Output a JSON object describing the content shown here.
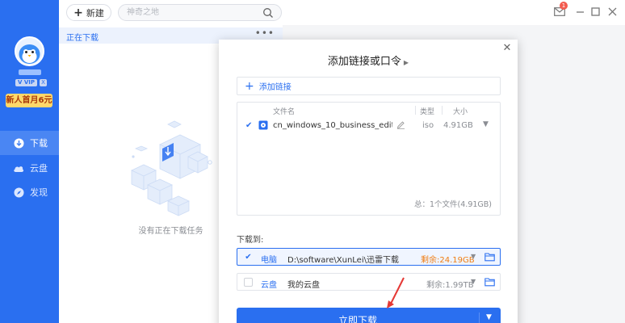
{
  "sidebar": {
    "promo_label": "新人首月6元",
    "vip_badge": "V VIP",
    "vip_x": "X",
    "nav": [
      {
        "label": "下载",
        "icon": "download-icon",
        "active": true
      },
      {
        "label": "云盘",
        "icon": "cloud-icon",
        "active": false
      },
      {
        "label": "发现",
        "icon": "compass-icon",
        "active": false
      }
    ]
  },
  "topbar": {
    "new_button": "新建",
    "search_placeholder": "神奇之地",
    "mail_badge_count": "1"
  },
  "download_list": {
    "header": "正在下载",
    "more": "•••",
    "empty_text": "没有正在下载任务"
  },
  "dialog": {
    "title": "添加链接或口令",
    "add_link_label": "添加链接",
    "columns": {
      "name": "文件名",
      "type": "类型",
      "size": "大小"
    },
    "file": {
      "name": "cn_windows_10_business_edition...",
      "type": "iso",
      "size": "4.91GB"
    },
    "total": "总：1个文件(4.91GB)",
    "save_to_label": "下载到:",
    "destinations": [
      {
        "label": "电脑",
        "path": "D:\\software\\XunLei\\迅雷下载",
        "free": "剩余:24.19GB",
        "checked": true
      },
      {
        "label": "云盘",
        "path": "我的云盘",
        "free": "剩余:1.99TB",
        "checked": false
      }
    ],
    "download_button": "立即下载"
  },
  "colors": {
    "brand_blue": "#2a6ff0",
    "orange": "#f07d12",
    "badge_red": "#f35b4f",
    "promo_yellow": "#ffd86a"
  }
}
